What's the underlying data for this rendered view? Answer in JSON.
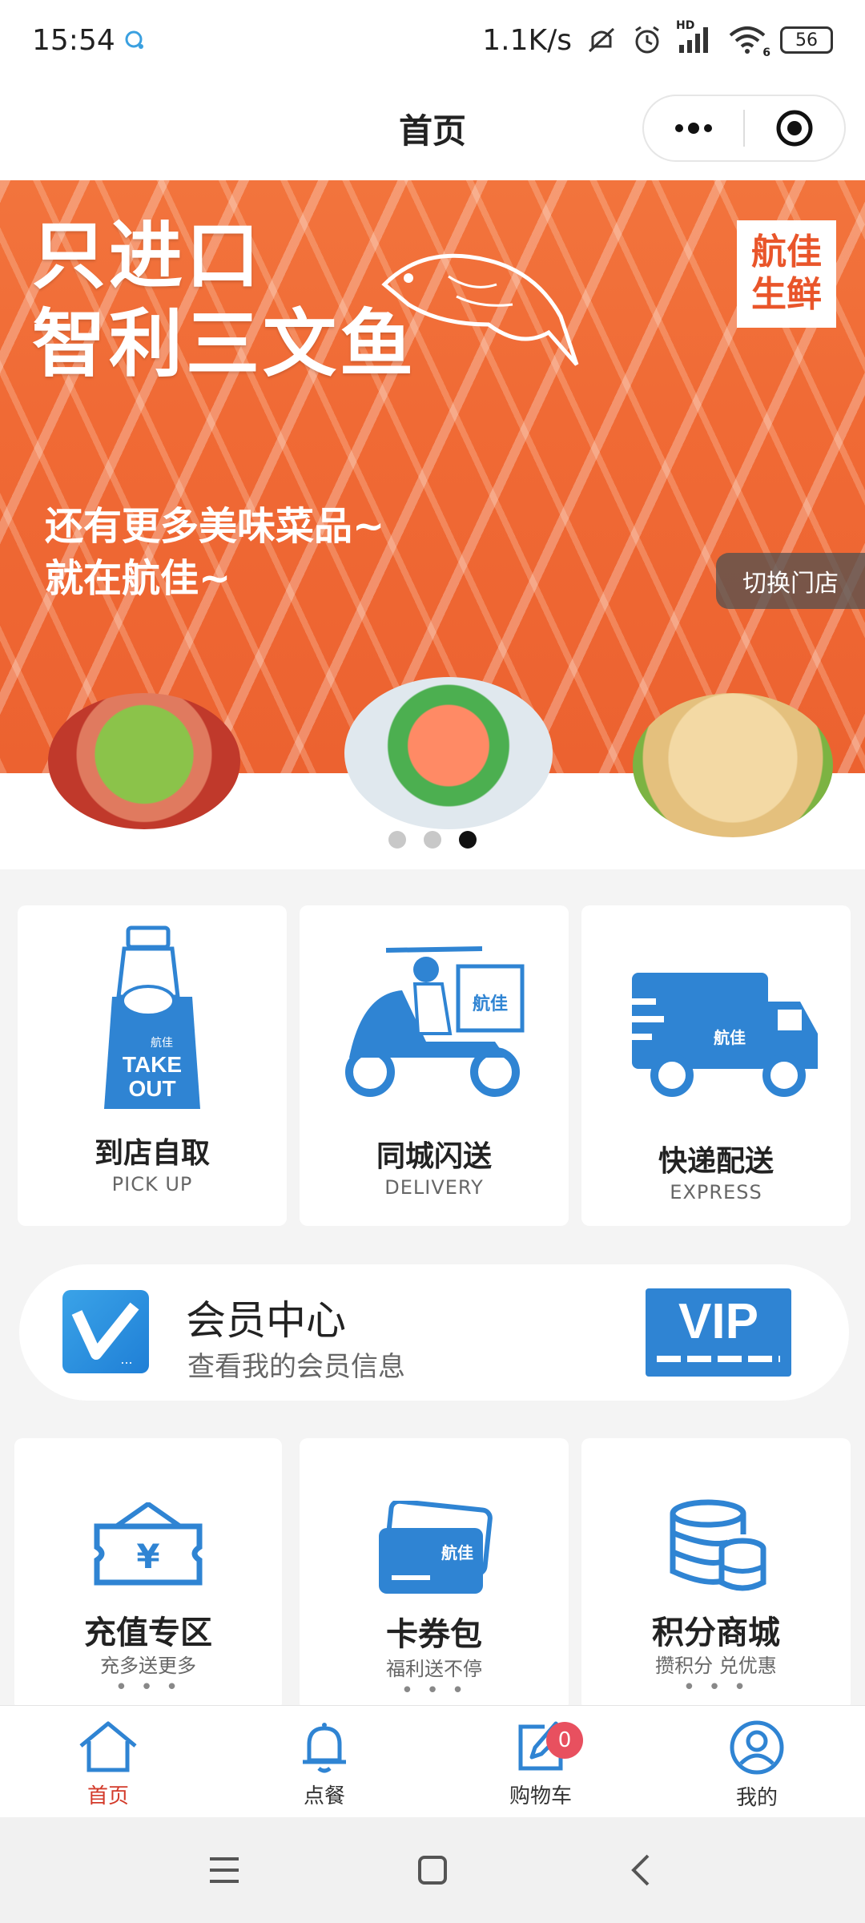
{
  "status_bar": {
    "time": "15:54",
    "net_speed": "1.1K/s",
    "battery": "56",
    "hd_label": "HD",
    "signal_label": "6"
  },
  "header": {
    "title": "首页"
  },
  "banner": {
    "headline_line1": "只进口",
    "headline_line2": "智利三文鱼",
    "sub_line1": "还有更多美味菜品~",
    "sub_line2": "就在航佳~",
    "badge_line1": "航佳",
    "badge_line2": "生鲜",
    "switch_store": "切换门店",
    "slides": 3,
    "active_slide": 3
  },
  "services": [
    {
      "title": "到店自取",
      "subtitle": "PICK UP",
      "icon": "takeout-bag-icon",
      "icon_text_1": "TAKE",
      "icon_text_2": "OUT",
      "brand_mark": "航佳"
    },
    {
      "title": "同城闪送",
      "subtitle": "DELIVERY",
      "icon": "scooter-delivery-icon",
      "brand_mark": "航佳"
    },
    {
      "title": "快递配送",
      "subtitle": "EXPRESS",
      "icon": "truck-icon",
      "brand_mark": "航佳"
    }
  ],
  "member": {
    "title": "会员中心",
    "subtitle": "查看我的会员信息",
    "vip_label": "VIP",
    "logo_dots": "..."
  },
  "features": [
    {
      "title": "充值专区",
      "subtitle": "充多送更多",
      "more": "• • •",
      "icon": "recharge-voucher-icon",
      "icon_glyph": "¥"
    },
    {
      "title": "卡券包",
      "subtitle": "福利送不停",
      "more": "• • •",
      "icon": "card-wallet-icon",
      "brand_mark": "航佳"
    },
    {
      "title": "积分商城",
      "subtitle": "攒积分 兑优惠",
      "more": "• • •",
      "icon": "coin-stack-icon"
    }
  ],
  "tab_bar": {
    "items": [
      {
        "label": "首页",
        "icon": "home-icon",
        "active": true
      },
      {
        "label": "点餐",
        "icon": "bell-icon",
        "active": false
      },
      {
        "label": "购物车",
        "icon": "edit-icon",
        "active": false,
        "badge": "0"
      },
      {
        "label": "我的",
        "icon": "user-icon",
        "active": false
      }
    ]
  },
  "colors": {
    "brand_blue": "#2f84d3",
    "accent_red": "#d33a2a",
    "salmon": "#f06a35",
    "badge_red": "#e8505f"
  }
}
